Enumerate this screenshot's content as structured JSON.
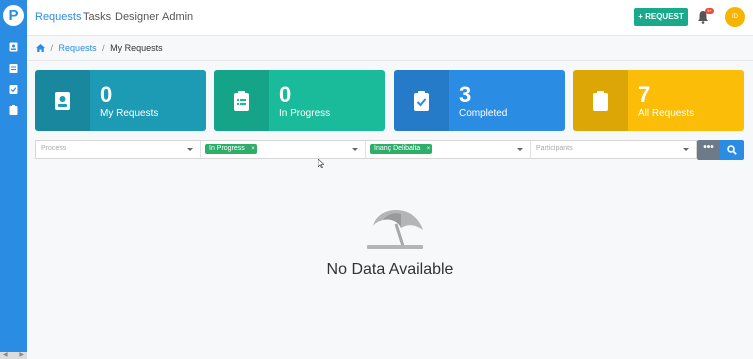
{
  "app": {
    "logo_letter": "P"
  },
  "nav": {
    "items": [
      {
        "label": "Requests",
        "active": true
      },
      {
        "label": "Tasks",
        "active": false
      },
      {
        "label": "Designer",
        "active": false
      },
      {
        "label": "Admin",
        "active": false
      }
    ],
    "request_button": "+ REQUEST",
    "notification_badge": "9+",
    "avatar_initials": "ID"
  },
  "breadcrumb": {
    "home_icon": "home-icon",
    "parent": "Requests",
    "current": "My Requests"
  },
  "cards": [
    {
      "count": "0",
      "label": "My Requests",
      "color": "#1d9bb5",
      "icon": "id-badge-icon"
    },
    {
      "count": "0",
      "label": "In Progress",
      "color": "#19bb9b",
      "icon": "clipboard-list-icon"
    },
    {
      "count": "3",
      "label": "Completed",
      "color": "#2b8ce3",
      "icon": "clipboard-check-icon"
    },
    {
      "count": "7",
      "label": "All Requests",
      "color": "#fbbd08",
      "icon": "clipboard-icon"
    }
  ],
  "filters": {
    "process_placeholder": "Process",
    "status_chip": "In Progress",
    "requester_chip": "İnanç Delibalta",
    "participants_placeholder": "Participants",
    "more_button": "•••"
  },
  "empty_state": {
    "message": "No Data Available",
    "icon": "beach-umbrella-icon"
  },
  "colors": {
    "primary": "#2b8ce3",
    "success": "#1aa98b",
    "chip": "#2fae6b",
    "avatar": "#f4b400",
    "badge": "#e74c3c"
  }
}
